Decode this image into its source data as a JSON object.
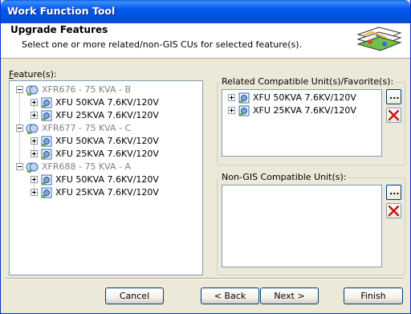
{
  "window": {
    "title": "Work Function Tool"
  },
  "header": {
    "title": "Upgrade Features",
    "subtitle": "Select one or more related/non-GIS CUs for selected feature(s)."
  },
  "features": {
    "label_prefix": "F",
    "label_rest": "eature(s):",
    "groups": [
      {
        "label": "XFR676 - 75 KVA - B",
        "children": [
          "XFU 50KVA 7.6KV/120V",
          "XFU 25KVA 7.6KV/120V"
        ]
      },
      {
        "label": "XFR677 - 75 KVA - C",
        "children": [
          "XFU 50KVA 7.6KV/120V",
          "XFU 25KVA 7.6KV/120V"
        ]
      },
      {
        "label": "XFR688 - 75 KVA - A",
        "children": [
          "XFU 50KVA 7.6KV/120V",
          "XFU 25KVA 7.6KV/120V"
        ]
      }
    ]
  },
  "related": {
    "label": "Related Compatible Unit(s)/Favorite(s):",
    "items": [
      "XFU 50KVA 7.6KV/120V",
      "XFU 25KVA 7.6KV/120V"
    ],
    "browse_label": "...",
    "delete_icon": "red-x-icon"
  },
  "nongis": {
    "label": "Non-GIS Compatible Unit(s):",
    "browse_label": "...",
    "delete_icon": "red-x-icon"
  },
  "buttons": {
    "cancel": "Cancel",
    "back": "< Back",
    "next": "Next >",
    "finish": "Finish"
  }
}
